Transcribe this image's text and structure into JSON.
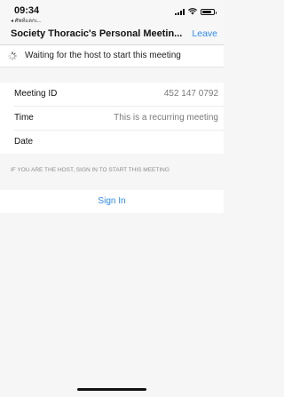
{
  "status_bar": {
    "time": "09:34",
    "back_app": "◂ ศัพท์แลกเ...",
    "signal_icon": "cellular-signal-icon",
    "wifi_icon": "wifi-icon",
    "battery_icon": "battery-icon",
    "battery_level": 0.85
  },
  "nav": {
    "title": "Society Thoracic's Personal Meetin...",
    "leave_label": "Leave",
    "accent_color": "#2d8cff"
  },
  "waiting": {
    "icon": "loading-spinner-icon",
    "text": "Waiting for the host to start this meeting"
  },
  "details": [
    {
      "label": "Meeting ID",
      "value": "452 147 0792"
    },
    {
      "label": "Time",
      "value": "This is a recurring meeting"
    },
    {
      "label": "Date",
      "value": ""
    }
  ],
  "host_note": "IF YOU ARE THE HOST, SIGN IN TO START THIS MEETING",
  "sign_in_label": "Sign In"
}
